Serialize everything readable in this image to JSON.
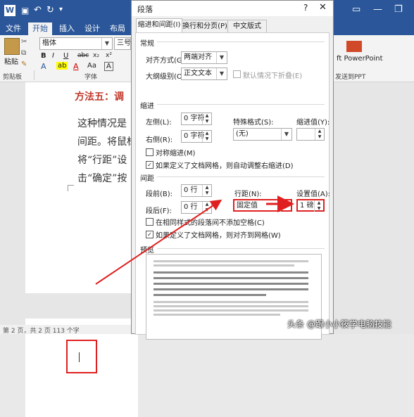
{
  "word": {
    "title_icons": [
      "word-logo-icon",
      "save-icon",
      "undo-icon",
      "redo-icon",
      "customize-icon"
    ],
    "tabs": [
      "文件",
      "开始",
      "插入",
      "设计",
      "布局"
    ],
    "ribbon": {
      "paste_label": "粘贴",
      "clipboard_label": "剪贴板",
      "font_name": "楷体",
      "font_size": "三号",
      "font_group_label": "字体",
      "ppt_label": "ft PowerPoint",
      "ppt_group_label": "发送到PPT"
    },
    "document": {
      "heading": "方法五：调",
      "lines": [
        "这种情况是",
        "间距。将鼠标",
        "将“行距”设",
        "击“确定”按"
      ]
    },
    "status": "第 2 页，共 2 页    113 个字"
  },
  "dialog": {
    "title": "段落",
    "tabs": [
      "缩进和间距(I)",
      "换行和分页(P)",
      "中文版式(H)"
    ],
    "general": {
      "section": "常规",
      "align_label": "对齐方式(G):",
      "align_value": "两端对齐",
      "outline_label": "大纲级别(O):",
      "outline_value": "正文文本",
      "collapse_label": "默认情况下折叠(E)"
    },
    "indent": {
      "section": "缩进",
      "left_label": "左侧(L):",
      "left_value": "0 字符",
      "right_label": "右侧(R):",
      "right_value": "0 字符",
      "special_label": "特殊格式(S):",
      "special_value": "(无)",
      "indent_value_label": "缩进值(Y):",
      "indent_value": "",
      "mirror_label": "对称缩进(M)",
      "auto_label": "如果定义了文档网格，则自动调整右缩进(D)"
    },
    "spacing": {
      "section": "间距",
      "before_label": "段前(B):",
      "before_value": "0 行",
      "after_label": "段后(F):",
      "after_value": "0 行",
      "line_label": "行距(N):",
      "line_value": "固定值",
      "at_label": "设置值(A):",
      "at_value": "1 磅",
      "nospace_label": "在相同样式的段落间不添加空格(C)",
      "grid_label": "如果定义了文档网格，则对齐到网格(W)"
    },
    "preview": {
      "section": "预览"
    }
  },
  "watermark": "头条 @跟小小筱学电脑技能",
  "colors": {
    "word_blue": "#2b579a",
    "highlight_red": "#e02020",
    "heading_red": "#c0392b"
  }
}
